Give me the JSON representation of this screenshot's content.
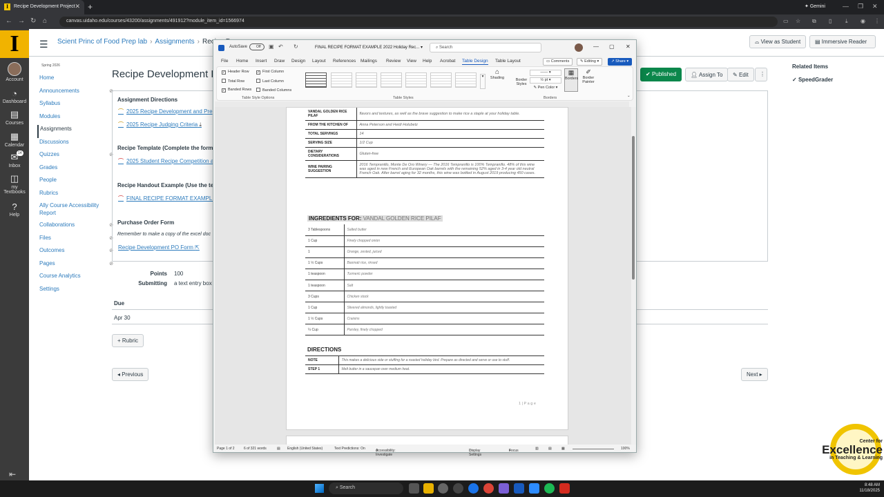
{
  "browser": {
    "tab_title": "Recipe Development Project",
    "url": "canvas.uidaho.edu/courses/43200/assignments/491912?module_item_id=1566974",
    "gemini_label": "Gemini"
  },
  "global_nav": {
    "items": [
      {
        "label": "Account",
        "icon": "user-avatar"
      },
      {
        "label": "Dashboard",
        "icon": "dashboard-icon"
      },
      {
        "label": "Courses",
        "icon": "book-icon"
      },
      {
        "label": "Calendar",
        "icon": "calendar-icon"
      },
      {
        "label": "Inbox",
        "icon": "inbox-icon",
        "badge": "14"
      },
      {
        "label": "my Textbooks",
        "icon": "book-open-icon"
      },
      {
        "label": "Help",
        "icon": "help-icon"
      }
    ]
  },
  "header": {
    "breadcrumb": [
      "Scient Princ of Food Prep lab",
      "Assignments",
      "Recipe De"
    ],
    "view_as_student": "View as Student",
    "immersive_reader": "Immersive Reader"
  },
  "course_nav": {
    "term": "Spring 2026",
    "items": [
      "Home",
      "Announcements",
      "Syllabus",
      "Modules",
      "Assignments",
      "Discussions",
      "Quizzes",
      "Grades",
      "People",
      "Rubrics",
      "Ally Course Accessibility Report",
      "Collaborations",
      "Files",
      "Outcomes",
      "Pages",
      "Course Analytics",
      "Settings"
    ]
  },
  "assignment": {
    "title": "Recipe Development Pr",
    "published": "Published",
    "assign_to": "Assign To",
    "edit": "Edit",
    "directions_heading": "Assignment Directions",
    "link1": "2025 Recipe Development and Pre",
    "link2": "2025 Recipe Judging Criteria",
    "template_heading": "Recipe Template (Complete the form as",
    "link3": "2025 Student Recipe Competition a",
    "handout_heading": "Recipe Handout Example (Use the temp",
    "link4": "FINAL RECIPE FORMAT EXAMPLE",
    "po_heading": "Purchase Order Form",
    "po_note": "Remember to make a copy of the excel doc",
    "link5": "Recipe Development PO Form",
    "points_label": "Points",
    "points_value": "100",
    "submitting_label": "Submitting",
    "submitting_value": "a text entry box",
    "due_label": "Due",
    "due_value": "Apr 30",
    "rubric": "Rubric",
    "previous": "Previous",
    "next": "Next"
  },
  "related": {
    "title": "Related Items",
    "speedgrader": "SpeedGrader"
  },
  "branding": {
    "line1": "Center for",
    "line2": "Excellence",
    "line3": "in Teaching & Learning"
  },
  "taskbar": {
    "search": "Search",
    "time": "8:48 AM",
    "date": "11/18/2025"
  },
  "word": {
    "autosave": "AutoSave",
    "toggle": "Off",
    "doc_title": "FINAL RECIPE FORMAT EXAMPLE 2022 Holiday Rec...",
    "search": "Search",
    "tabs": [
      "File",
      "Home",
      "Insert",
      "Draw",
      "Design",
      "Layout",
      "References",
      "Mailings",
      "Review",
      "View",
      "Help",
      "Acrobat",
      "Table Design",
      "Table Layout"
    ],
    "comments": "Comments",
    "editing": "Editing",
    "share": "Share",
    "options": [
      "Header Row",
      "First Column",
      "Total Row",
      "Last Column",
      "Banded Rows",
      "Banded Columns"
    ],
    "group_options": "Table Style Options",
    "group_styles": "Table Styles",
    "group_borders": "Borders",
    "shading": "Shading",
    "border_styles": "Border Styles",
    "pen_weight": "½ pt",
    "pen_color": "Pen Color",
    "borders": "Borders",
    "border_painter": "Border Painter",
    "status": {
      "page": "Page 1 of 2",
      "words": "6 of 321 words",
      "language": "English (United States)",
      "predictions": "Text Predictions: On",
      "accessibility": "Accessibility: Investigate",
      "display": "Display Settings",
      "focus": "Focus",
      "zoom": "100%"
    }
  },
  "recipe": {
    "info_rows": [
      {
        "key": "VANDAL GOLDEN RICE PILAF",
        "value": "flavors and textures, as well as the brave suggestion to make rice a staple at your holiday table."
      },
      {
        "key": "FROM THE KITCHEN OF",
        "value": "Anna Peterson and Heidi Holubetz"
      },
      {
        "key": "TOTAL SERVINGS",
        "value": "14"
      },
      {
        "key": "SERVING SIZE",
        "value": "1/2 Cup"
      },
      {
        "key": "DIETARY CONSIDERATIONS",
        "value": "Gluten-free"
      },
      {
        "key": "WINE PAIRING SUGGESTION",
        "value": "2016 Tempranillo, Monte De Oro Winery — The 2016 Tempranillo is 100% Tempranillo. 48% of this wine was aged in new French and European Oak barrels with the remaining 52% aged in 3-4 year old neutral French Oak. After barrel aging for 32 months, this wine was bottled in August 2019 producing 450 cases."
      }
    ],
    "ingredients_label": "INGREDIENTS FOR:",
    "dish_name": "VANDAL GOLDEN RICE PILAF",
    "ingredients": [
      {
        "qty": "3 Tablespoons",
        "item": "Salted butter"
      },
      {
        "qty": "1 Cup",
        "item": "Finely chopped onion"
      },
      {
        "qty": "1",
        "item": "Orange, zested, juiced"
      },
      {
        "qty": "1 ½  Cups",
        "item": "Basmati rice, rinsed"
      },
      {
        "qty": "1 teaspoon",
        "item": "Turmeric powder"
      },
      {
        "qty": "1 teaspoon",
        "item": "Salt"
      },
      {
        "qty": "3 Cups",
        "item": "Chicken stock"
      },
      {
        "qty": "1 Cup",
        "item": "Slivered almonds, lightly toasted"
      },
      {
        "qty": "1 ½ Cups",
        "item": "Craisins"
      },
      {
        "qty": "¼ Cup",
        "item": "Parsley, finely chopped"
      }
    ],
    "directions_label": "DIRECTIONS",
    "directions": [
      {
        "key": "NOTE",
        "value": "This makes a delicious side or stuffing for a roasted holiday bird. Prepare as directed and serve or use to stuff."
      },
      {
        "key": "STEP 1",
        "value": "Melt butter in a saucepan over medium heat."
      }
    ],
    "page_footer": "1 | P a g e"
  }
}
